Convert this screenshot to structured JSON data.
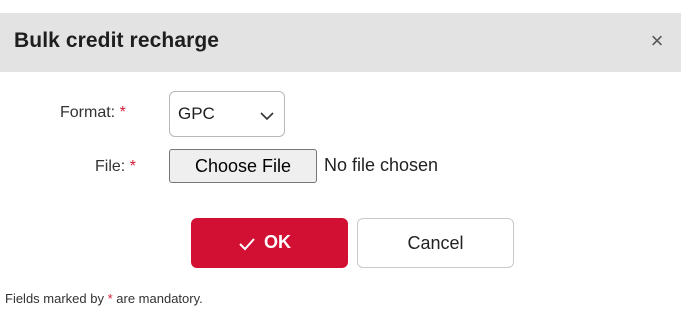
{
  "dialog": {
    "title": "Bulk credit recharge",
    "close_glyph": "×"
  },
  "form": {
    "format_label": "Format:",
    "file_label": "File:",
    "required_mark": "*",
    "format_value": "GPC",
    "file_button_label": "Choose File",
    "file_status": "No file chosen"
  },
  "buttons": {
    "ok_label": "OK",
    "cancel_label": "Cancel"
  },
  "footnote": {
    "before": "Fields marked by ",
    "mark": "*",
    "after": " are mandatory."
  },
  "colors": {
    "accent": "#d21034",
    "titlebar": "#e3e3e3",
    "required": "#d21b34"
  },
  "icons": [
    "close-icon",
    "chevron-down-icon",
    "check-icon"
  ]
}
